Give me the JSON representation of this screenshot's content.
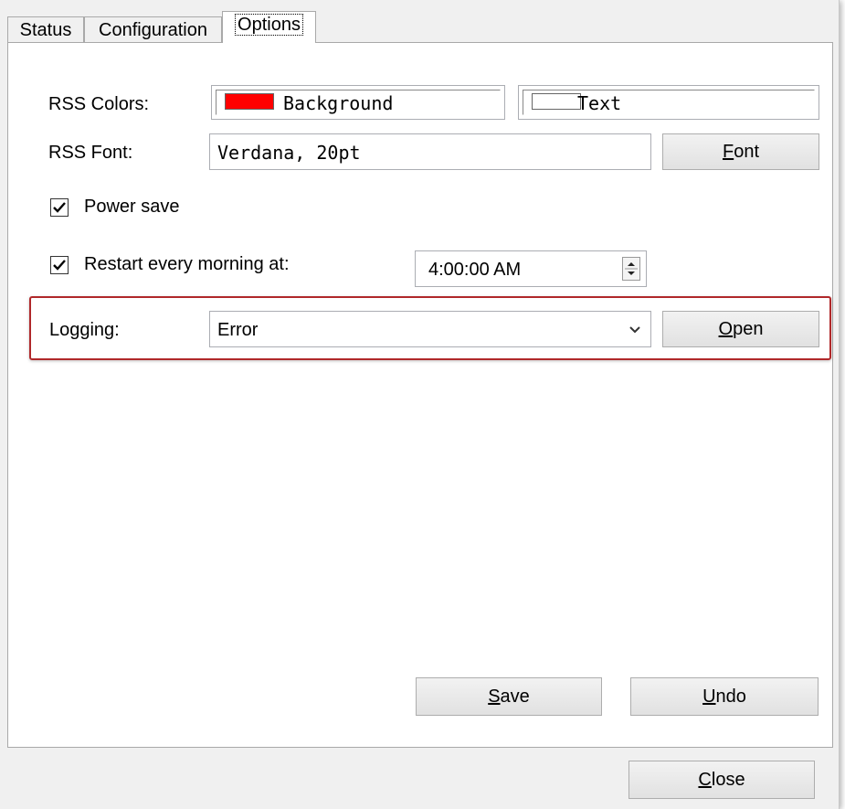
{
  "tabs": [
    {
      "label": "Status"
    },
    {
      "label": "Configuration"
    },
    {
      "label": "Options"
    }
  ],
  "rss_colors": {
    "label": "RSS Colors:",
    "background": {
      "label": "Background",
      "color": "#ff0000"
    },
    "text": {
      "label": "Text",
      "color": "#ffffff"
    }
  },
  "rss_font": {
    "label": "RSS Font:",
    "value": "Verdana, 20pt",
    "button_label_accel": "F",
    "button_label_rest": "ont"
  },
  "power_save": {
    "label": "Power save",
    "checked": true
  },
  "restart": {
    "label": "Restart every morning at:",
    "checked": true,
    "time": "4:00:00 AM"
  },
  "logging": {
    "label": "Logging:",
    "selected": "Error",
    "open_accel": "O",
    "open_rest": "pen"
  },
  "actions": {
    "save_accel": "S",
    "save_rest": "ave",
    "undo_accel": "U",
    "undo_rest": "ndo"
  },
  "footer": {
    "close_accel": "C",
    "close_rest": "lose"
  },
  "colors": {
    "highlight": "#b0282a"
  }
}
